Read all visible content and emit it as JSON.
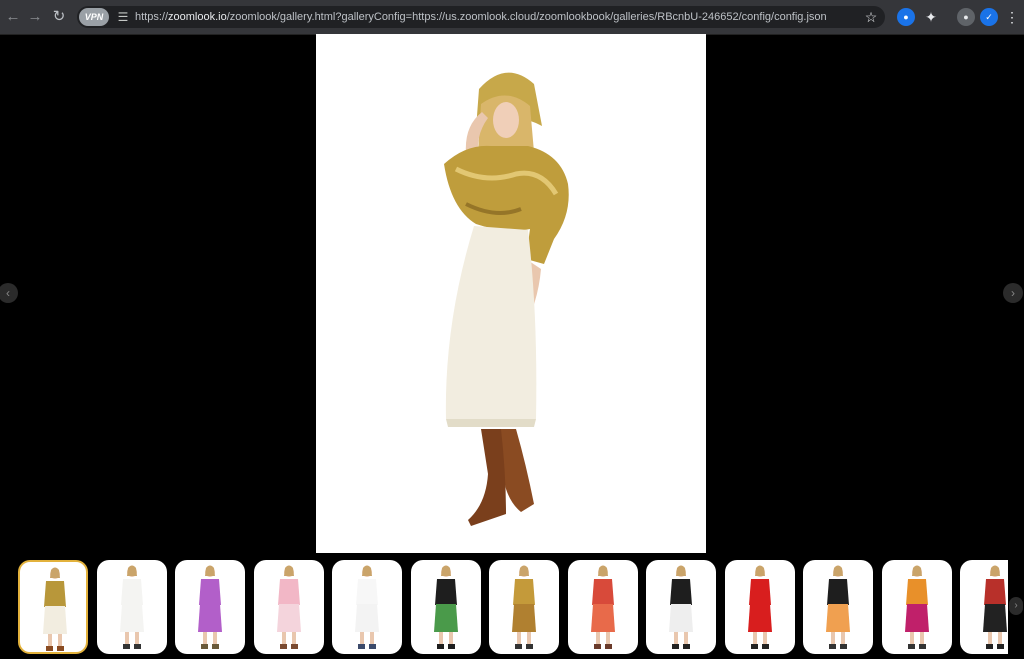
{
  "browser": {
    "back_icon": "arrow-left-icon",
    "forward_icon": "arrow-right-icon",
    "reload_icon": "reload-icon",
    "vpn_label": "VPN",
    "url_prefix": "https://",
    "url_host": "zoomlook.io",
    "url_rest": "/zoomlook/gallery.html?galleryConfig=https://us.zoomlook.cloud/zoomlookbook/galleries/RBcnbU-246652/config/config.json",
    "accent": "#1a73e8"
  },
  "gallery": {
    "thumb_border_color": "#e3b23c",
    "thumbnails": [
      {
        "outfit": "gold hooded jacket, white knit skirt, brown boots",
        "top": "#b8973a",
        "bottom": "#f2ede0",
        "shoes": "#8a4b22",
        "active": true
      },
      {
        "outfit": "white coat dress",
        "top": "#f4f4f2",
        "bottom": "#f4f4f2",
        "shoes": "#333333"
      },
      {
        "outfit": "purple coat",
        "top": "#b25fc9",
        "bottom": "#b25fc9",
        "shoes": "#6a5a3a"
      },
      {
        "outfit": "pink floral blouse and shorts",
        "top": "#f2b7c6",
        "bottom": "#f4d4dc",
        "shoes": "#7a4a30"
      },
      {
        "outfit": "white crop top and skirt",
        "top": "#f7f7f7",
        "bottom": "#f3f3f3",
        "shoes": "#3c4a6a"
      },
      {
        "outfit": "black jacket, green patterned skirt",
        "top": "#1e1e1e",
        "bottom": "#4a9a4a",
        "shoes": "#1e1e1e"
      },
      {
        "outfit": "gold printed dress",
        "top": "#c49a3a",
        "bottom": "#b08030",
        "shoes": "#333333"
      },
      {
        "outfit": "red and orange dress",
        "top": "#d84a3a",
        "bottom": "#e86a4a",
        "shoes": "#6a3a2a"
      },
      {
        "outfit": "black jacket, white tulle skirt",
        "top": "#1e1e1e",
        "bottom": "#eeeeee",
        "shoes": "#222222"
      },
      {
        "outfit": "red vinyl coat",
        "top": "#d81e1e",
        "bottom": "#d81e1e",
        "shoes": "#222222"
      },
      {
        "outfit": "black long coat, orange skirt",
        "top": "#1e1e1e",
        "bottom": "#f0a050",
        "shoes": "#333333"
      },
      {
        "outfit": "orange coat, magenta pants",
        "top": "#e8902a",
        "bottom": "#c0206a",
        "shoes": "#333333"
      },
      {
        "outfit": "red top, black sheer skirt",
        "top": "#b8302a",
        "bottom": "#222222",
        "shoes": "#222222"
      }
    ]
  }
}
